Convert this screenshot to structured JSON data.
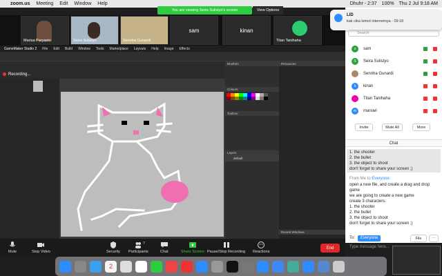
{
  "menubar": {
    "apple": "",
    "app": "zoom.us",
    "items": [
      "Meeting",
      "Edit",
      "Window",
      "Help"
    ],
    "battery": "100%",
    "clock": "Thu 2 Jul  9:18 AM",
    "user": "Dhuhr - 2:37"
  },
  "banner": {
    "text": "You are viewing Seira Sulistyo's screen",
    "options": "View Options"
  },
  "thumbs": [
    {
      "name": "Marisa Paryasto"
    },
    {
      "name": "Seira Sulistyo"
    },
    {
      "name": "Sennha Gunardi"
    },
    {
      "name": "sam"
    },
    {
      "name": "kinan"
    },
    {
      "name": "Titan Tanihaha"
    }
  ],
  "notification": {
    "title": "LID",
    "body": "kak cika lemot internetnya - 09:18"
  },
  "gm": {
    "title": "GameMaker Studio 2",
    "menu": [
      "File",
      "Edit",
      "Build",
      "Window",
      "Tools",
      "Marketplace",
      "Layouts",
      "Help",
      "Image",
      "Effects"
    ],
    "recording": "Recording...",
    "resources": "Resources",
    "brushes": "Brushes",
    "colours": "Colours",
    "toolbox": "Toolbox",
    "layers": "Layers",
    "layer_default": "default",
    "recent": "Recent Windows"
  },
  "side": {
    "search_placeholder": "Search",
    "participants": [
      {
        "name": "sam",
        "color": "#2ea043"
      },
      {
        "name": "Seira Sulistyo",
        "color": "#2ea043"
      },
      {
        "name": "Sennha Gunardi",
        "color": "#7a5"
      },
      {
        "name": "kinan",
        "color": "#2d8cff"
      },
      {
        "name": "Titan Tanihaha",
        "color": "#e0a"
      },
      {
        "name": "manuel",
        "color": "#2d8cff"
      }
    ],
    "invite": "Invite",
    "mute_all": "Mute All",
    "more": "More"
  },
  "chat": {
    "header": "Chat",
    "lines_top": [
      "1. the shooter",
      "2. the bullet",
      "3. the object to shoot",
      "don't forget to share your screen ;)"
    ],
    "from": "From Me to",
    "everyone": "Everyone:",
    "lines": [
      "open a new file, and create a drag and drop",
      "game",
      "we are going to create a new game",
      "create 3 characters:",
      "1. the shooter",
      "2. the bullet",
      "3. the object to shoot",
      "don't forget to share your screen ;)"
    ],
    "to_label": "To:",
    "to_value": "Everyone",
    "file": "File",
    "placeholder": "Type message here..."
  },
  "bottom": {
    "mute": "Mute",
    "video": "Stop Video",
    "security": "Security",
    "participants": "Participants",
    "participants_count": "7",
    "chat": "Chat",
    "share": "Share Screen",
    "pause": "Pause/Stop Recording",
    "reactions": "Reactions",
    "end": "End"
  },
  "dock_day": "2"
}
